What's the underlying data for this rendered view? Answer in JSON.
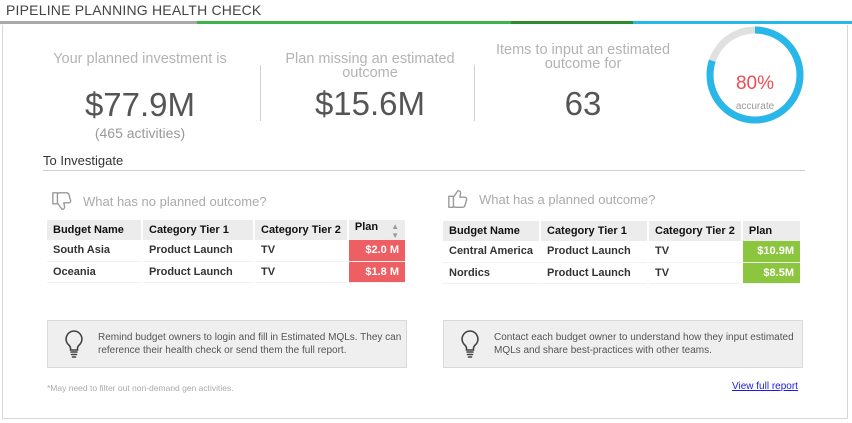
{
  "header": {
    "title": "PIPELINE PLANNING HEALTH CHECK"
  },
  "colors": {
    "bar_segments": [
      "#a9a9a9",
      "#3cb44b",
      "#2e8b2e",
      "#29b6e8"
    ],
    "gauge_accent": "#29b6e8",
    "gauge_track": "#e0e0e0",
    "plan_negative": "#ee5f63",
    "plan_positive": "#8cc63f"
  },
  "stats": {
    "investment": {
      "label_line1": "Your planned investment is",
      "value": "$77.9M",
      "sub": "(465 activities)"
    },
    "missing": {
      "label_line1": "Plan missing an estimated",
      "label_line2": "outcome",
      "value": "$15.6M"
    },
    "items": {
      "label_line1": "Items to input an estimated",
      "label_line2": "outcome for",
      "value": "63"
    }
  },
  "gauge": {
    "percent_text": "80%",
    "percent_value": 0.8,
    "label": "accurate"
  },
  "investigate": {
    "title": "To Investigate"
  },
  "no_outcome": {
    "question": "What has no planned outcome?",
    "icon": "thumbs-down-icon",
    "columns": [
      "Budget Name",
      "Category Tier 1",
      "Category Tier 2",
      "Plan"
    ],
    "rows": [
      {
        "budget": "South Asia",
        "tier1": "Product Launch",
        "tier2": "TV",
        "plan": "$2.0 M"
      },
      {
        "budget": "Oceania",
        "tier1": "Product Launch",
        "tier2": "TV",
        "plan": "$1.8 M"
      }
    ],
    "tip": "Remind budget owners to login and fill in Estimated MQLs. They can reference their health check or send them the full report."
  },
  "planned_outcome": {
    "question": "What has a planned outcome?",
    "icon": "thumbs-up-icon",
    "columns": [
      "Budget Name",
      "Category Tier 1",
      "Category Tier 2",
      "Plan"
    ],
    "rows": [
      {
        "budget": "Central America",
        "tier1": "Product Launch",
        "tier2": "TV",
        "plan": "$10.9M"
      },
      {
        "budget": "Nordics",
        "tier1": "Product Launch",
        "tier2": "TV",
        "plan": "$8.5M"
      }
    ],
    "tip": "Contact each budget owner to understand how they input estimated MQLs and share best-practices with other teams."
  },
  "footer": {
    "note": "*May need to filter out non-demand gen activities.",
    "link": "View full report"
  }
}
